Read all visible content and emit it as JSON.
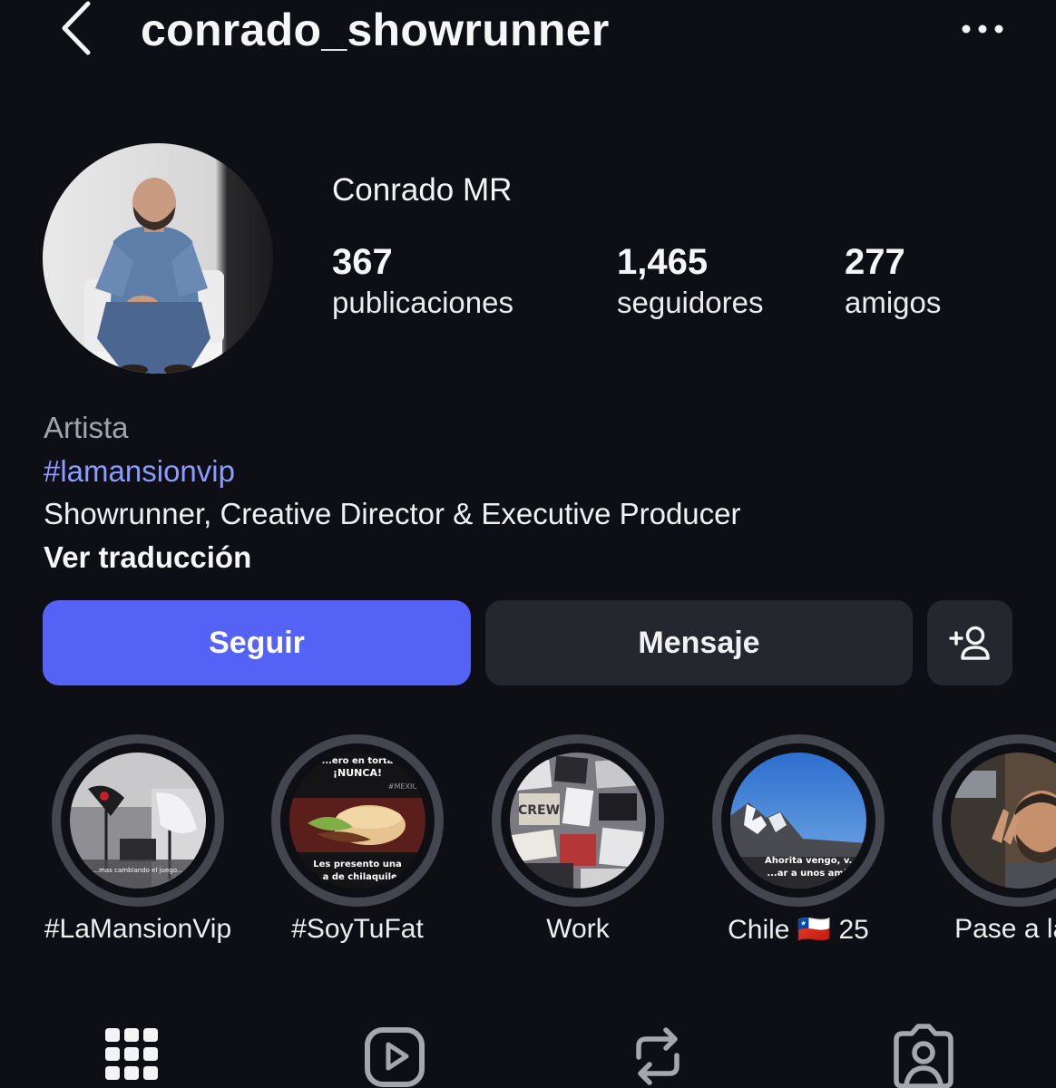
{
  "header": {
    "username": "conrado_showrunner",
    "back_icon": "chevron-left-icon",
    "more_icon": "more-horizontal-icon"
  },
  "profile": {
    "display_name": "Conrado MR",
    "stats": [
      {
        "value": "367",
        "label": "publicaciones"
      },
      {
        "value": "1,465",
        "label": "seguidores"
      },
      {
        "value": "277",
        "label": "amigos"
      }
    ]
  },
  "bio": {
    "category": "Artista",
    "hashtag": "#lamansionvip",
    "description": "Showrunner, Creative Director & Executive Producer",
    "translate_link": "Ver traducción"
  },
  "actions": {
    "follow_label": "Seguir",
    "message_label": "Mensaje",
    "add_user_icon": "person-add-icon"
  },
  "highlights": [
    {
      "label": "#LaMansionVip",
      "caption": "...mas cambiando el juego..."
    },
    {
      "label": "#SoyTuFat",
      "top_text": "...ero en torta",
      "mid_text": "¡NUNCA!",
      "tag": "#MEXICO",
      "bottom_text": "Les presento una",
      "bottom_text2": "...a de chilaquiles"
    },
    {
      "label": "Work",
      "sign": "CREW"
    },
    {
      "label": "Chile 🇨🇱 25",
      "caption": "Ahorita vengo, v...",
      "caption2": "...ar a unos ami..."
    },
    {
      "label": "Pase a la f"
    }
  ],
  "tabs": [
    {
      "icon": "grid-icon"
    },
    {
      "icon": "reels-icon"
    },
    {
      "icon": "reposts-icon"
    },
    {
      "icon": "tagged-icon"
    }
  ],
  "colors": {
    "background": "#0e0f14",
    "accent": "#5462f6",
    "hashtag": "#8c9bff",
    "secondary_button": "#25272e"
  }
}
